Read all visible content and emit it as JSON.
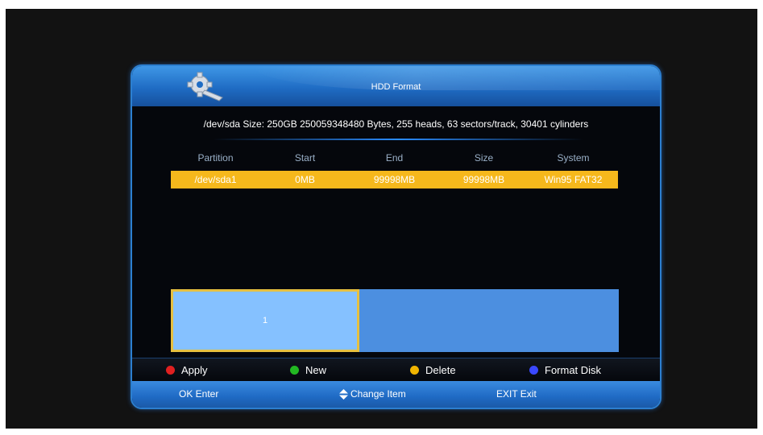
{
  "window": {
    "title": "HDD Format"
  },
  "disk_info": "/dev/sda Size: 250GB 250059348480 Bytes, 255 heads, 63 sectors/track, 30401 cylinders",
  "table": {
    "headers": [
      "Partition",
      "Start",
      "End",
      "Size",
      "System"
    ],
    "rows": [
      [
        "/dev/sda1",
        "0MB",
        "99998MB",
        "99998MB",
        "Win95 FAT32"
      ]
    ],
    "selected_row_color": "#f6b81c"
  },
  "partition_map": {
    "blocks": [
      {
        "label": "1",
        "fraction": 0.41
      }
    ],
    "used_color": "#85c1ff",
    "free_color": "#4c8fe0"
  },
  "color_keys": {
    "red": {
      "label": "Apply",
      "color": "#e02020"
    },
    "green": {
      "label": "New",
      "color": "#22b822"
    },
    "yellow": {
      "label": "Delete",
      "color": "#f0b400"
    },
    "blue": {
      "label": "Format Disk",
      "color": "#3a48ff"
    }
  },
  "nav_hints": {
    "ok": "OK Enter",
    "updown": "Change Item",
    "exit": "EXIT Exit"
  },
  "icons": {
    "title": "settings-gear-icon",
    "updown": "up-down-arrow-icon"
  }
}
